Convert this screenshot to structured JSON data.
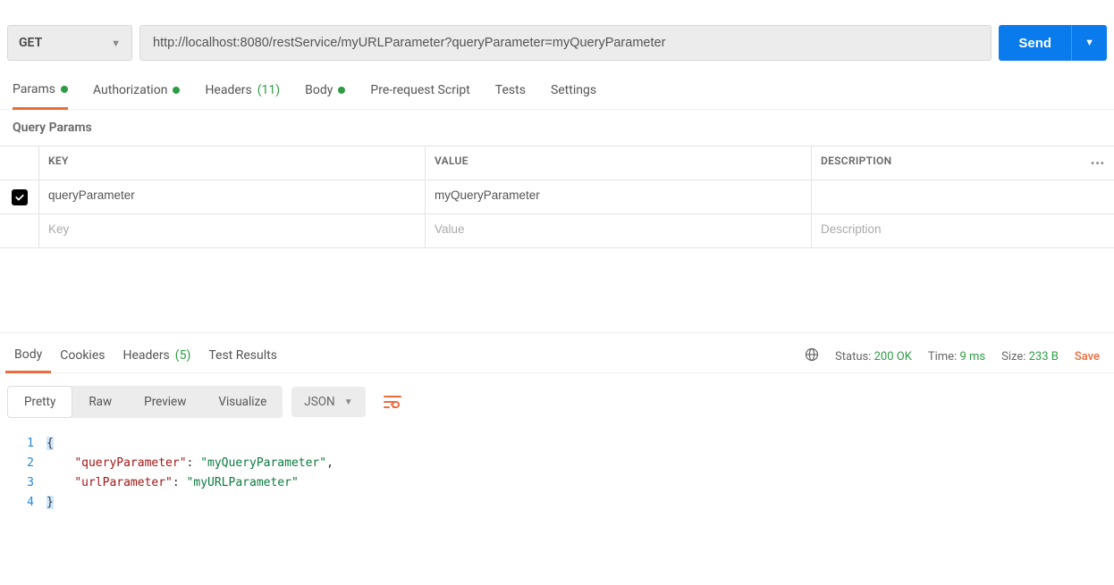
{
  "request": {
    "method": "GET",
    "url": "http://localhost:8080/restService/myURLParameter?queryParameter=myQueryParameter",
    "sendLabel": "Send"
  },
  "requestTabs": {
    "params": {
      "label": "Params",
      "dot": true,
      "active": true
    },
    "auth": {
      "label": "Authorization",
      "dot": true
    },
    "headers": {
      "label": "Headers",
      "count": "(11)"
    },
    "body": {
      "label": "Body",
      "dot": true
    },
    "prereq": {
      "label": "Pre-request Script"
    },
    "tests": {
      "label": "Tests"
    },
    "settings": {
      "label": "Settings"
    }
  },
  "querySection": {
    "title": "Query Params",
    "columns": {
      "key": "KEY",
      "value": "VALUE",
      "desc": "DESCRIPTION"
    },
    "rows": [
      {
        "checked": true,
        "key": "queryParameter",
        "value": "myQueryParameter",
        "desc": ""
      }
    ],
    "emptyRow": {
      "key": "Key",
      "value": "Value",
      "desc": "Description"
    }
  },
  "responseTabs": {
    "body": {
      "label": "Body",
      "active": true
    },
    "cookies": {
      "label": "Cookies"
    },
    "headers": {
      "label": "Headers",
      "count": "(5)"
    },
    "testResults": {
      "label": "Test Results"
    }
  },
  "responseMeta": {
    "statusLabel": "Status:",
    "statusValue": "200 OK",
    "timeLabel": "Time:",
    "timeValue": "9 ms",
    "sizeLabel": "Size:",
    "sizeValue": "233 B",
    "saveLabel": "Save"
  },
  "viewModes": {
    "pretty": "Pretty",
    "raw": "Raw",
    "preview": "Preview",
    "visualize": "Visualize",
    "format": "JSON"
  },
  "responseBody": {
    "lines": [
      {
        "n": "1",
        "tokens": [
          {
            "t": "sel",
            "v": "{"
          }
        ]
      },
      {
        "n": "2",
        "tokens": [
          {
            "t": "plain",
            "v": "    "
          },
          {
            "t": "key",
            "v": "\"queryParameter\""
          },
          {
            "t": "punc",
            "v": ": "
          },
          {
            "t": "str",
            "v": "\"myQueryParameter\""
          },
          {
            "t": "punc",
            "v": ","
          }
        ]
      },
      {
        "n": "3",
        "tokens": [
          {
            "t": "plain",
            "v": "    "
          },
          {
            "t": "key",
            "v": "\"urlParameter\""
          },
          {
            "t": "punc",
            "v": ": "
          },
          {
            "t": "str",
            "v": "\"myURLParameter\""
          }
        ]
      },
      {
        "n": "4",
        "tokens": [
          {
            "t": "sel",
            "v": "}"
          }
        ]
      }
    ]
  }
}
